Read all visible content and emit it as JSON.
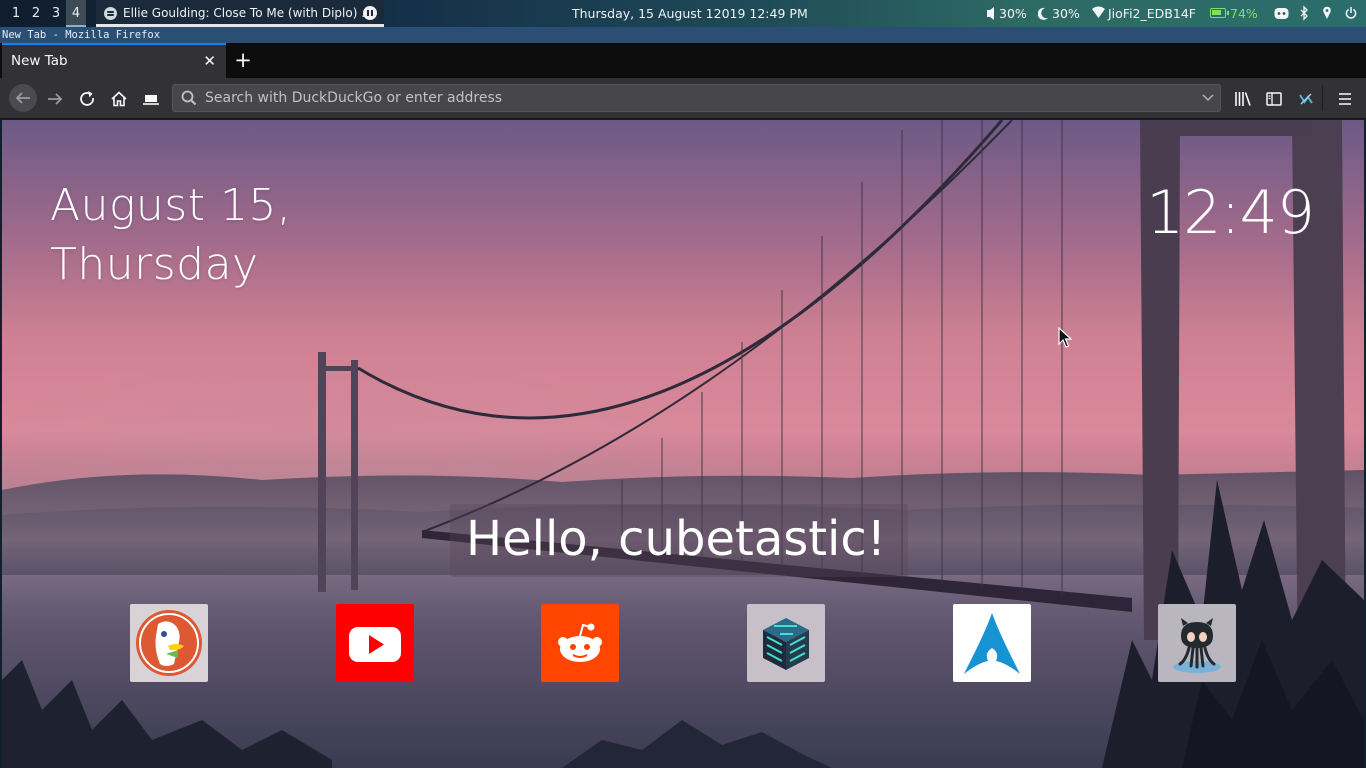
{
  "topbar": {
    "workspaces": [
      "1",
      "2",
      "3",
      "4"
    ],
    "active_workspace": "4",
    "media_title": "Ellie Goulding: Close To Me (with Diplo) ...",
    "datetime": "Thursday, 15 August 12019 12:49 PM",
    "volume": "30%",
    "brightness": "30%",
    "wifi": "JioFi2_EDB14F",
    "battery": "74%",
    "icons": [
      "speaker-icon",
      "moon-icon",
      "wifi-icon",
      "battery-icon",
      "discord-icon",
      "bluetooth-icon",
      "location-icon",
      "power-icon"
    ]
  },
  "window": {
    "title": "New Tab - Mozilla Firefox"
  },
  "browser": {
    "tab_label": "New Tab",
    "tab_close": "✕",
    "new_tab": "+",
    "url_placeholder": "Search with DuckDuckGo or enter address",
    "nav_icons": [
      "back-icon",
      "forward-icon",
      "reload-icon",
      "home-icon",
      "screenshot-icon"
    ],
    "toolbar_icons": [
      "library-icon",
      "sidebar-icon",
      "extension-icon",
      "menu-icon"
    ]
  },
  "page": {
    "date_line1": "August 15,",
    "date_line2": "Thursday",
    "time": "12:49",
    "greeting": "Hello, cubetastic!",
    "shortcuts": [
      {
        "name": "DuckDuckGo",
        "icon": "duckduckgo-icon",
        "color": "#de5833"
      },
      {
        "name": "YouTube",
        "icon": "youtube-icon",
        "color": "#ff0000"
      },
      {
        "name": "Reddit",
        "icon": "reddit-icon",
        "color": "#ff4500"
      },
      {
        "name": "Cube",
        "icon": "cube-icon",
        "color": "#2d2b4a"
      },
      {
        "name": "Arch Linux",
        "icon": "archlinux-icon",
        "color": "#1793d1"
      },
      {
        "name": "GitHub",
        "icon": "github-icon",
        "color": "#24292e"
      }
    ]
  }
}
